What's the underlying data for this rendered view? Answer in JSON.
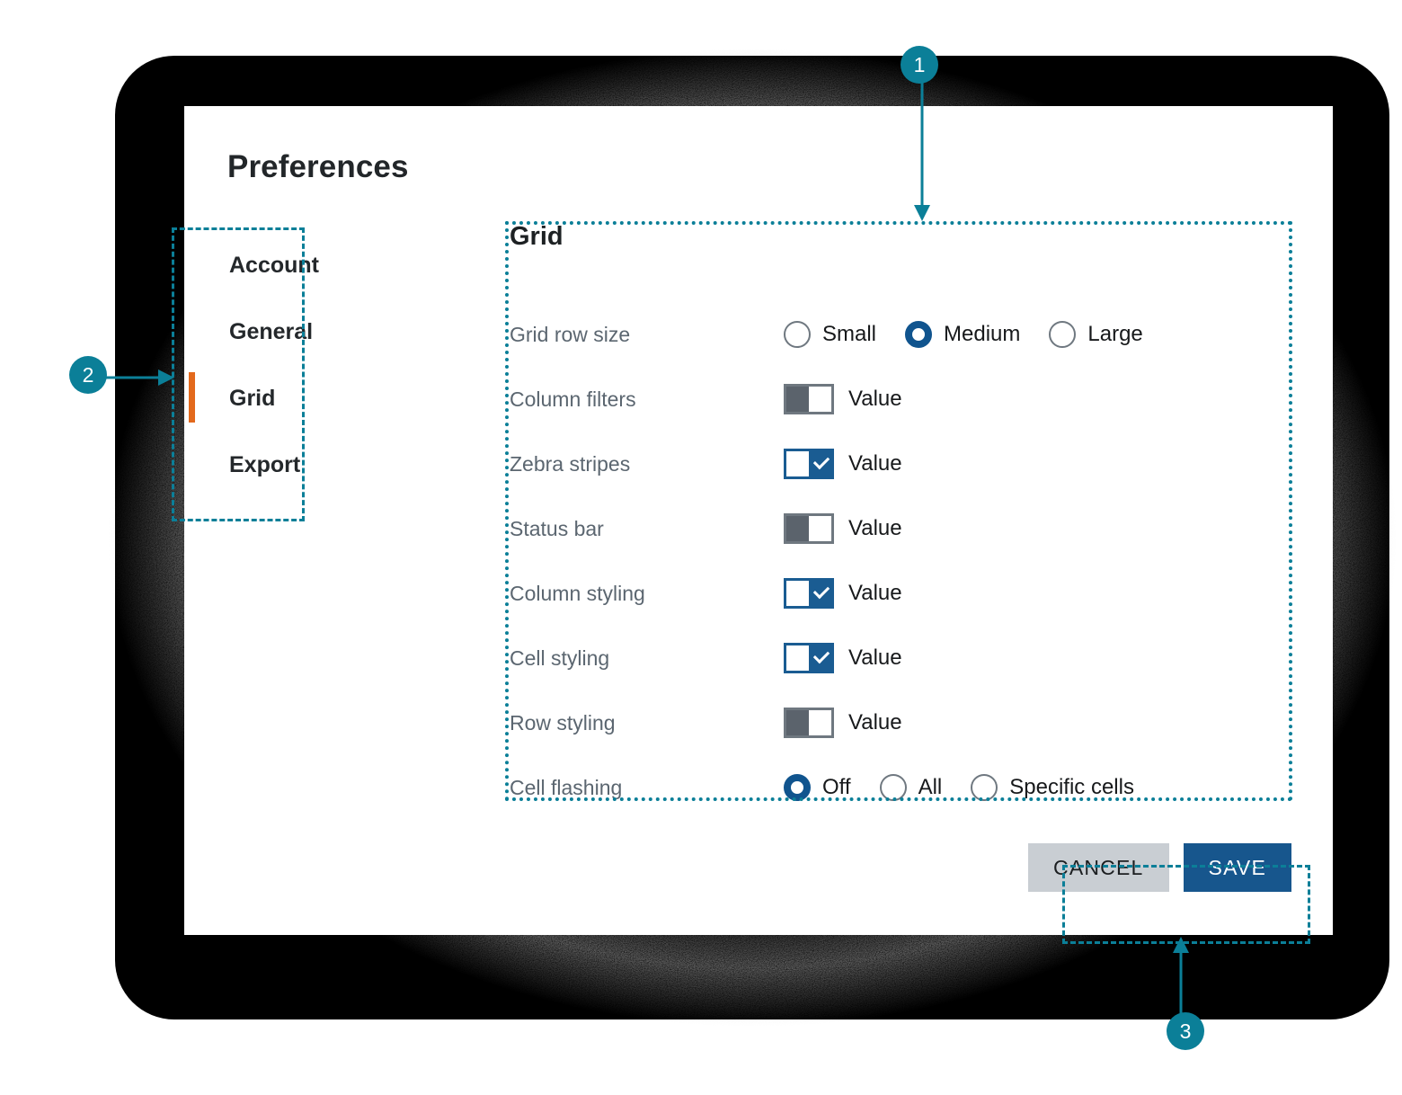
{
  "dialog": {
    "title": "Preferences",
    "section_title": "Grid"
  },
  "sidebar": {
    "items": [
      {
        "label": "Account",
        "selected": false
      },
      {
        "label": "General",
        "selected": false
      },
      {
        "label": "Grid",
        "selected": true
      },
      {
        "label": "Export",
        "selected": false
      }
    ]
  },
  "fields": [
    {
      "label": "Grid row size",
      "control": "radio",
      "options": [
        {
          "label": "Small",
          "selected": false
        },
        {
          "label": "Medium",
          "selected": true
        },
        {
          "label": "Large",
          "selected": false
        }
      ]
    },
    {
      "label": "Column filters",
      "control": "toggle",
      "on": false,
      "value_label": "Value"
    },
    {
      "label": "Zebra stripes",
      "control": "toggle",
      "on": true,
      "value_label": "Value"
    },
    {
      "label": "Status bar",
      "control": "toggle",
      "on": false,
      "value_label": "Value"
    },
    {
      "label": "Column styling",
      "control": "toggle",
      "on": true,
      "value_label": "Value"
    },
    {
      "label": "Cell styling",
      "control": "toggle",
      "on": true,
      "value_label": "Value"
    },
    {
      "label": "Row styling",
      "control": "toggle",
      "on": false,
      "value_label": "Value"
    },
    {
      "label": "Cell flashing",
      "control": "radio",
      "options": [
        {
          "label": "Off",
          "selected": true
        },
        {
          "label": "All",
          "selected": false
        },
        {
          "label": "Specific cells",
          "selected": false
        }
      ]
    }
  ],
  "footer": {
    "cancel_label": "CANCEL",
    "save_label": "SAVE"
  },
  "annotations": [
    {
      "number": "1",
      "target": "grid-settings-panel"
    },
    {
      "number": "2",
      "target": "sidebar-navigation"
    },
    {
      "number": "3",
      "target": "dialog-action-buttons"
    }
  ],
  "colors": {
    "accent_orange": "#e3691c",
    "primary_blue": "#17568d",
    "annotation_teal": "#0b7f98",
    "cancel_gray": "#c9ced3"
  }
}
